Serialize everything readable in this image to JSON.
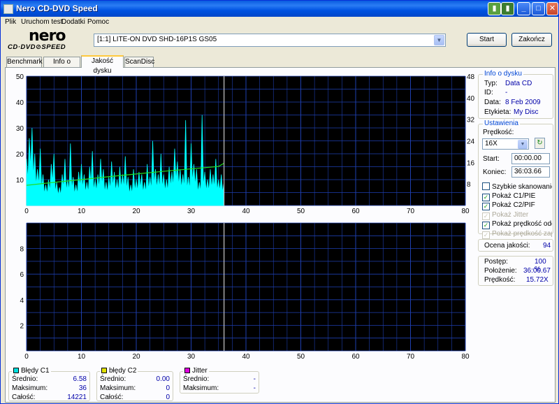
{
  "window": {
    "title": "Nero CD-DVD Speed"
  },
  "menu": [
    "Plik",
    "Uruchom test",
    "Dodatki",
    "Pomoc"
  ],
  "logo": {
    "line1": "nero",
    "line2": "CD·DVD⊘SPEED"
  },
  "drive": {
    "selected": "[1:1]  LITE-ON DVD SHD-16P1S GS05"
  },
  "buttons": {
    "start": "Start",
    "stop": "Zakończ"
  },
  "tabs": [
    "Benchmark",
    "Info o dysku",
    "Jakość dysku",
    "ScanDisc"
  ],
  "active_tab": 2,
  "disc_info": {
    "title": "Info o dysku",
    "rows": [
      {
        "label": "Typ:",
        "value": "Data CD"
      },
      {
        "label": "ID:",
        "value": "-"
      },
      {
        "label": "Data:",
        "value": "8 Feb 2009"
      },
      {
        "label": "Etykieta:",
        "value": "My Disc"
      }
    ]
  },
  "settings": {
    "title": "Ustawienia",
    "speed_label": "Prędkość:",
    "speed_value": "16X",
    "start_label": "Start:",
    "start_value": "00:00.00",
    "end_label": "Koniec:",
    "end_value": "36:03.66",
    "checkboxes": [
      {
        "label": "Szybkie skanowanie",
        "checked": false,
        "disabled": false
      },
      {
        "label": "Pokaż C1/PIE",
        "checked": true,
        "disabled": false
      },
      {
        "label": "Pokaż C2/PIF",
        "checked": true,
        "disabled": false
      },
      {
        "label": "Pokaż Jitter",
        "checked": true,
        "disabled": true
      },
      {
        "label": "Pokaż prędkość odczytu",
        "checked": true,
        "disabled": false
      },
      {
        "label": "Pokaż prędkość zapisu",
        "checked": true,
        "disabled": true
      }
    ]
  },
  "quality": {
    "label": "Ocena jakości:",
    "value": "94"
  },
  "progress": {
    "rows": [
      {
        "label": "Postęp:",
        "value": "100 %"
      },
      {
        "label": "Położenie:",
        "value": "36:00.67"
      },
      {
        "label": "Prędkość:",
        "value": "15.72X"
      }
    ]
  },
  "legend": {
    "c1": {
      "title": "Błędy C1",
      "color": "#00e0e0",
      "rows": [
        {
          "label": "Średnio:",
          "value": "6.58"
        },
        {
          "label": "Maksimum:",
          "value": "36"
        },
        {
          "label": "Całość:",
          "value": "14221"
        }
      ]
    },
    "c2": {
      "title": "błędy C2",
      "color": "#e0e000",
      "rows": [
        {
          "label": "Średnio:",
          "value": "0.00"
        },
        {
          "label": "Maksimum:",
          "value": "0"
        },
        {
          "label": "Całość:",
          "value": "0"
        }
      ]
    },
    "jitter": {
      "title": "Jitter",
      "color": "#e000e0",
      "rows": [
        {
          "label": "Średnio:",
          "value": "-"
        },
        {
          "label": "Maksimum:",
          "value": "-"
        }
      ]
    }
  },
  "colors": {
    "plot_bg": "#000000",
    "grid": "#1e3fb0",
    "c1": "#00ffff",
    "speed": "#22dd22",
    "cursor": "#c8c8c8"
  },
  "chart_data": [
    {
      "type": "area",
      "xlim": [
        0,
        80
      ],
      "ylim": [
        0,
        50
      ],
      "y2lim": [
        0,
        48
      ],
      "x_ticks": [
        0,
        10,
        20,
        30,
        40,
        50,
        60,
        70,
        80
      ],
      "y_ticks": [
        10,
        20,
        30,
        40,
        50
      ],
      "y2_ticks": [
        8,
        16,
        24,
        32,
        40,
        48
      ],
      "cursor_x": 36,
      "series": [
        {
          "values_x": [
            0,
            0.5,
            1,
            1.5,
            2,
            2.5,
            3,
            3.5,
            4,
            4.5,
            5,
            5.5,
            6,
            6.5,
            7,
            7.5,
            8,
            8.5,
            9,
            9.5,
            10,
            10.5,
            11,
            11.5,
            12,
            12.5,
            13,
            13.5,
            14,
            14.5,
            15,
            15.5,
            16,
            16.5,
            17,
            17.5,
            18,
            18.5,
            19,
            19.5,
            20,
            20.5,
            21,
            21.5,
            22,
            22.5,
            23,
            23.5,
            24,
            24.5,
            25,
            25.5,
            26,
            26.5,
            27,
            27.5,
            28,
            28.5,
            29,
            29.5,
            30,
            30.5,
            31,
            31.5,
            32,
            32.5,
            33,
            33.5,
            34,
            34.5,
            35,
            35.5,
            36
          ],
          "values_y": [
            18,
            26,
            30,
            20,
            14,
            22,
            12,
            8,
            10,
            16,
            20,
            9,
            7,
            12,
            18,
            10,
            24,
            11,
            8,
            13,
            16,
            12,
            9,
            15,
            21,
            10,
            12,
            18,
            14,
            9,
            11,
            17,
            13,
            10,
            15,
            12,
            19,
            11,
            8,
            14,
            10,
            13,
            12,
            9,
            16,
            11,
            25,
            14,
            12,
            20,
            12,
            10,
            15,
            13,
            22,
            17,
            14,
            12,
            33,
            11,
            24,
            16,
            14,
            9,
            35,
            13,
            10,
            14,
            12,
            18,
            10,
            12,
            9
          ]
        },
        {
          "values_x": [
            0,
            5,
            10,
            15,
            20,
            25,
            30,
            35,
            36
          ],
          "values_y2": [
            7.5,
            8.6,
            9.6,
            10.7,
            11.7,
            12.7,
            13.6,
            14.5,
            15.7
          ]
        }
      ]
    },
    {
      "type": "area",
      "xlim": [
        0,
        80
      ],
      "ylim": [
        0,
        10
      ],
      "x_ticks": [
        0,
        10,
        20,
        30,
        40,
        50,
        60,
        70,
        80
      ],
      "y_ticks": [
        2,
        4,
        6,
        8
      ],
      "cursor_x": 36,
      "series": [
        {
          "values_x": [],
          "values_y": []
        }
      ]
    }
  ]
}
